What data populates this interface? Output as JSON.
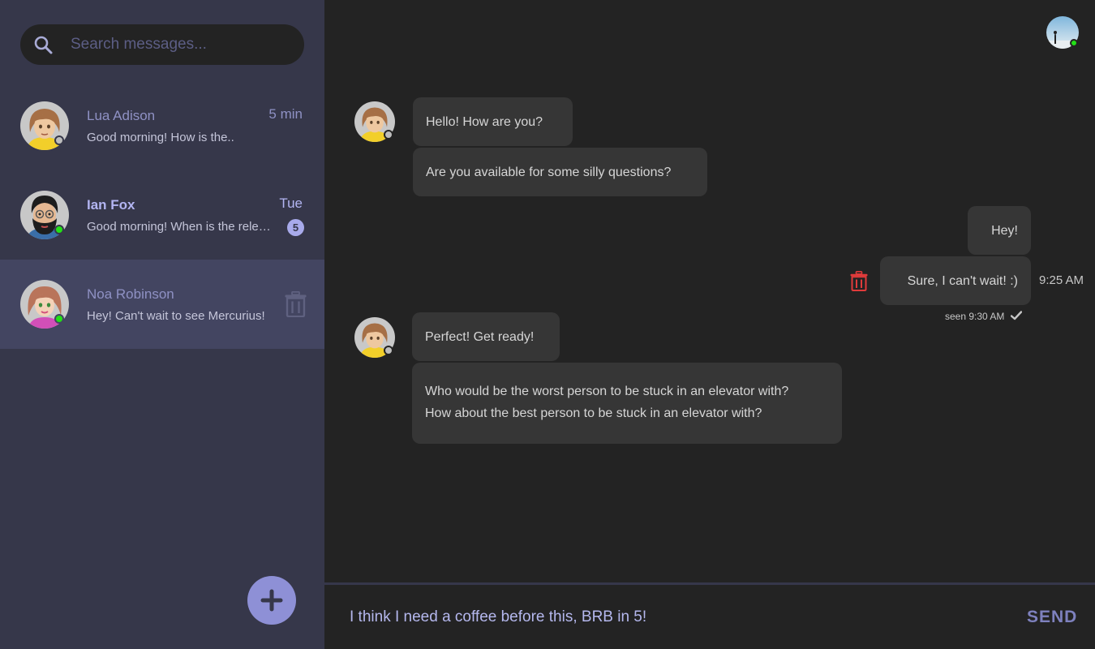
{
  "sidebar": {
    "search": {
      "placeholder": "Search messages..."
    },
    "conversations": [
      {
        "name": "Lua Adison",
        "preview": "Good morning! How is the..",
        "time": "5 min",
        "status": "offline"
      },
      {
        "name": "Ian Fox",
        "preview": "Good morning! When is the release date?",
        "time": "Tue",
        "unread": "5",
        "status": "online"
      },
      {
        "name": "Noa Robinson",
        "preview": "Hey! Can't wait to see Mercurius!",
        "status": "online"
      }
    ],
    "fab_icon": "plus-icon"
  },
  "chat": {
    "messages": [
      {
        "direction": "in",
        "lines": [
          "Hello! How are you?"
        ]
      },
      {
        "direction": "in",
        "lines": [
          "Are you available for some silly questions?"
        ]
      },
      {
        "direction": "out",
        "lines": [
          "Hey!"
        ]
      },
      {
        "direction": "out",
        "lines": [
          "Sure, I can't wait! :)"
        ],
        "time": "9:25 AM",
        "seen": "seen 9:30 AM"
      },
      {
        "direction": "in",
        "lines": [
          "Perfect! Get ready!"
        ]
      },
      {
        "direction": "in",
        "lines": [
          "Who would be the worst person to be stuck in an elevator with?",
          "How about the best person to be stuck in an elevator with?"
        ]
      }
    ]
  },
  "composer": {
    "value": "I think I need a coffee before this, BRB in 5!",
    "send_label": "SEND"
  },
  "colors": {
    "accent": "#8e90d6",
    "sidebar_bg": "#36374a",
    "main_bg": "#232323",
    "bubble_bg": "#363636",
    "online": "#22e016",
    "delete": "#e03b3b"
  },
  "icons": [
    "search-icon",
    "trash-icon",
    "plus-icon",
    "check-icon"
  ]
}
